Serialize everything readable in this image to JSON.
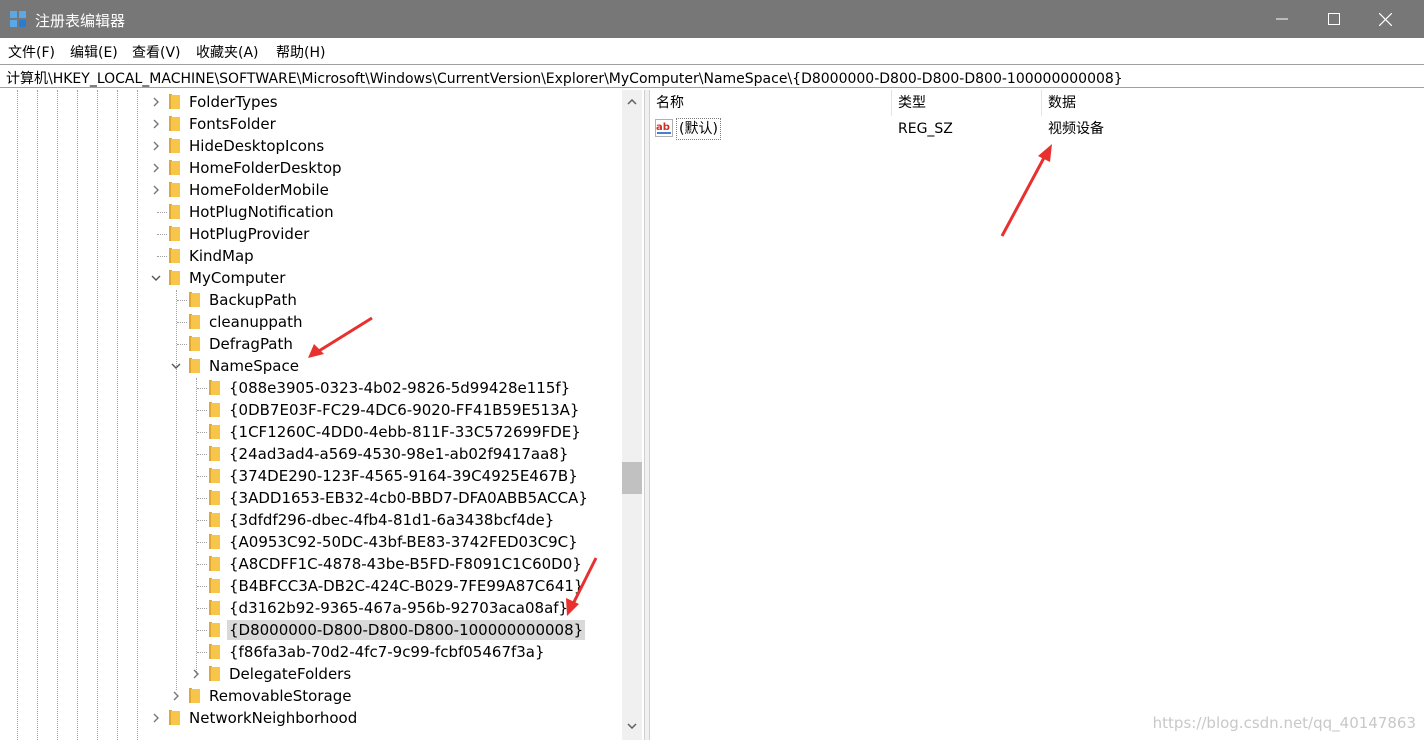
{
  "window": {
    "title": "注册表编辑器"
  },
  "menu": [
    "文件(F)",
    "编辑(E)",
    "查看(V)",
    "收藏夹(A)",
    "帮助(H)"
  ],
  "address": "计算机\\HKEY_LOCAL_MACHINE\\SOFTWARE\\Microsoft\\Windows\\CurrentVersion\\Explorer\\MyComputer\\NameSpace\\{D8000000-D800-D800-D800-100000000008}",
  "tree": {
    "nodes": [
      {
        "label": "FolderTypes",
        "level": 0,
        "toggle": "collapsed"
      },
      {
        "label": "FontsFolder",
        "level": 0,
        "toggle": "collapsed"
      },
      {
        "label": "HideDesktopIcons",
        "level": 0,
        "toggle": "collapsed"
      },
      {
        "label": "HomeFolderDesktop",
        "level": 0,
        "toggle": "collapsed"
      },
      {
        "label": "HomeFolderMobile",
        "level": 0,
        "toggle": "collapsed"
      },
      {
        "label": "HotPlugNotification",
        "level": 0,
        "toggle": "none"
      },
      {
        "label": "HotPlugProvider",
        "level": 0,
        "toggle": "none"
      },
      {
        "label": "KindMap",
        "level": 0,
        "toggle": "none"
      },
      {
        "label": "MyComputer",
        "level": 0,
        "toggle": "expanded"
      },
      {
        "label": "BackupPath",
        "level": 1,
        "toggle": "none"
      },
      {
        "label": "cleanuppath",
        "level": 1,
        "toggle": "none"
      },
      {
        "label": "DefragPath",
        "level": 1,
        "toggle": "none"
      },
      {
        "label": "NameSpace",
        "level": 1,
        "toggle": "expanded"
      },
      {
        "label": "{088e3905-0323-4b02-9826-5d99428e115f}",
        "level": 2,
        "toggle": "none"
      },
      {
        "label": "{0DB7E03F-FC29-4DC6-9020-FF41B59E513A}",
        "level": 2,
        "toggle": "none"
      },
      {
        "label": "{1CF1260C-4DD0-4ebb-811F-33C572699FDE}",
        "level": 2,
        "toggle": "none"
      },
      {
        "label": "{24ad3ad4-a569-4530-98e1-ab02f9417aa8}",
        "level": 2,
        "toggle": "none"
      },
      {
        "label": "{374DE290-123F-4565-9164-39C4925E467B}",
        "level": 2,
        "toggle": "none"
      },
      {
        "label": "{3ADD1653-EB32-4cb0-BBD7-DFA0ABB5ACCA}",
        "level": 2,
        "toggle": "none"
      },
      {
        "label": "{3dfdf296-dbec-4fb4-81d1-6a3438bcf4de}",
        "level": 2,
        "toggle": "none"
      },
      {
        "label": "{A0953C92-50DC-43bf-BE83-3742FED03C9C}",
        "level": 2,
        "toggle": "none"
      },
      {
        "label": "{A8CDFF1C-4878-43be-B5FD-F8091C1C60D0}",
        "level": 2,
        "toggle": "none"
      },
      {
        "label": "{B4BFCC3A-DB2C-424C-B029-7FE99A87C641}",
        "level": 2,
        "toggle": "none"
      },
      {
        "label": "{d3162b92-9365-467a-956b-92703aca08af}",
        "level": 2,
        "toggle": "none"
      },
      {
        "label": "{D8000000-D800-D800-D800-100000000008}",
        "level": 2,
        "toggle": "none",
        "selected": true
      },
      {
        "label": "{f86fa3ab-70d2-4fc7-9c99-fcbf05467f3a}",
        "level": 2,
        "toggle": "none"
      },
      {
        "label": "DelegateFolders",
        "level": 2,
        "toggle": "collapsed"
      },
      {
        "label": "RemovableStorage",
        "level": 1,
        "toggle": "collapsed"
      },
      {
        "label": "NetworkNeighborhood",
        "level": 0,
        "toggle": "collapsed"
      }
    ]
  },
  "list": {
    "columns": [
      "名称",
      "类型",
      "数据"
    ],
    "rows": [
      {
        "name": "(默认)",
        "type": "REG_SZ",
        "data": "视频设备"
      }
    ]
  },
  "watermark": "https://blog.csdn.net/qq_40147863",
  "colors": {
    "titlebar": "#777777",
    "arrow": "#e8312f",
    "folder": "#f7c54a"
  }
}
